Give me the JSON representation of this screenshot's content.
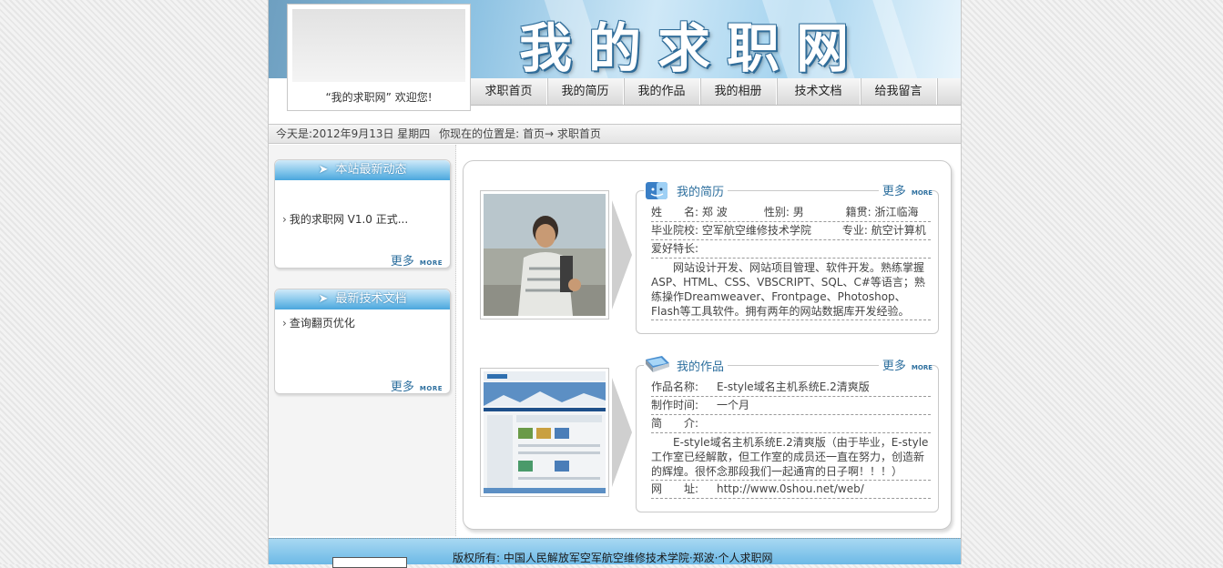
{
  "header": {
    "site_title": "我的求职网",
    "welcome": "“我的求职网” 欢迎您!"
  },
  "nav": {
    "items": [
      "求职首页",
      "我的简历",
      "我的作品",
      "我的相册",
      "技术文档",
      "给我留言"
    ]
  },
  "breadcrumb": {
    "date": "今天是:2012年9月13日 星期四",
    "location": "你现在的位置是: 首页→ 求职首页"
  },
  "sidebar": {
    "news": {
      "title": "本站最新动态",
      "items": [
        "我的求职网 V1.0 正式..."
      ],
      "more": "更多",
      "more_tag": "MORE"
    },
    "docs": {
      "title": "最新技术文档",
      "items": [
        "查询翻页优化"
      ],
      "more": "更多",
      "more_tag": "MORE"
    }
  },
  "resume": {
    "title": "我的简历",
    "more": "更多",
    "more_tag": "MORE",
    "name_label": "姓　　名:",
    "name": "郑 波",
    "gender_label": "性别:",
    "gender": "男",
    "hometown_label": "籍贯:",
    "hometown": "浙江临海",
    "school_label": "毕业院校:",
    "school": "空军航空维修技术学院",
    "major_label": "专业:",
    "major": "航空计算机",
    "hobby_label": "爱好特长:",
    "hobby_text": "网站设计开发、网站项目管理、软件开发。熟练掌握ASP、HTML、CSS、VBSCRIPT、SQL、C#等语言；熟练操作Dreamweaver、Frontpage、Photoshop、Flash等工具软件。拥有两年的网站数据库开发经验。"
  },
  "works": {
    "title": "我的作品",
    "more": "更多",
    "more_tag": "MORE",
    "work_name_label": "作品名称:",
    "work_name": "E-style域名主机系统E.2清爽版",
    "time_label": "制作时间:",
    "time": "一个月",
    "intro_label": "简　　介:",
    "intro_text": "E-style域名主机系统E.2清爽版（由于毕业，E-style工作室已经解散，但工作室的成员还一直在努力，创造新的辉煌。很怀念那段我们一起通宵的日子啊！！！）",
    "url_label": "网　　址:",
    "url": "http://www.0shou.net/web/"
  },
  "footer": {
    "copyright": "版权所有: 中国人民解放军空军航空维修技术学院·郑波·个人求职网"
  },
  "colors": {
    "accent": "#2d6f9e",
    "panel_head": "#4aa6dd",
    "footer": "#6cb9e6"
  }
}
